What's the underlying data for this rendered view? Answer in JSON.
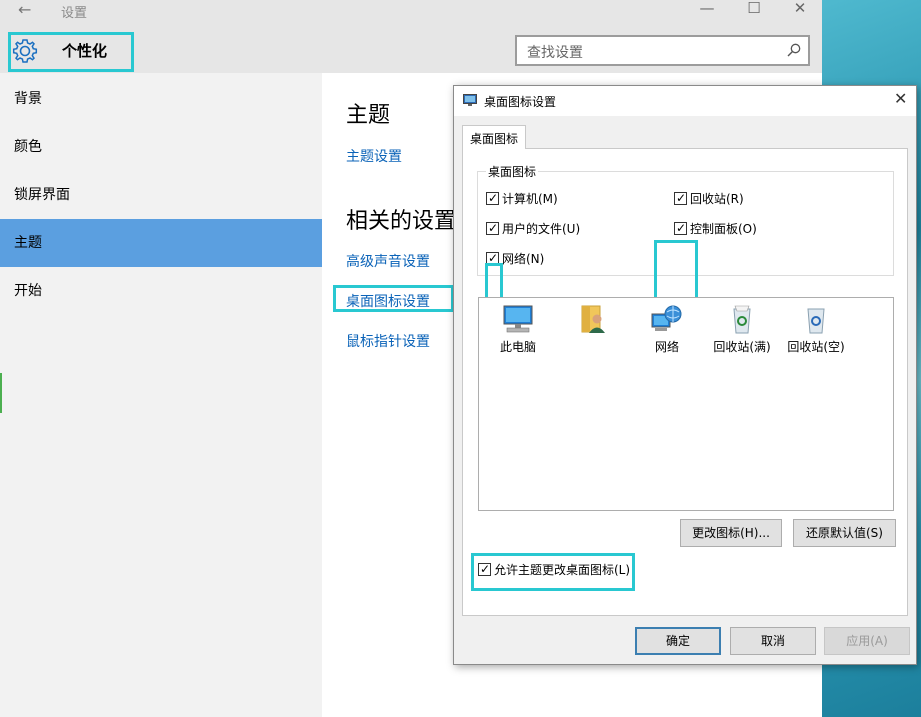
{
  "settings": {
    "title": "设置",
    "header_title": "个性化",
    "search_placeholder": "查找设置",
    "nav": [
      "背景",
      "颜色",
      "锁屏界面",
      "主题",
      "开始"
    ],
    "selected_nav": "主题",
    "content": {
      "heading_theme": "主题",
      "link_theme_settings": "主题设置",
      "heading_related": "相关的设置",
      "link_sound": "高级声音设置",
      "link_desktop_icons": "桌面图标设置",
      "link_mouse": "鼠标指针设置"
    }
  },
  "dialog": {
    "title": "桌面图标设置",
    "tab": "桌面图标",
    "group_label": "桌面图标",
    "checkboxes": {
      "computer": "计算机(M)",
      "user_files": "用户的文件(U)",
      "network": "网络(N)",
      "recycle_bin": "回收站(R)",
      "control_panel": "控制面板(O)"
    },
    "icons": {
      "this_pc": "此电脑",
      "user": "",
      "network": "网络",
      "recycle_full": "回收站(满)",
      "recycle_empty": "回收站(空)"
    },
    "btn_change_icon": "更改图标(H)...",
    "btn_restore": "还原默认值(S)",
    "allow_themes": "允许主题更改桌面图标(L)",
    "btn_ok": "确定",
    "btn_cancel": "取消",
    "btn_apply": "应用(A)"
  },
  "colors": {
    "highlight": "#29c8d1",
    "selected_nav": "#5b9fe0",
    "link": "#0b63b8"
  }
}
